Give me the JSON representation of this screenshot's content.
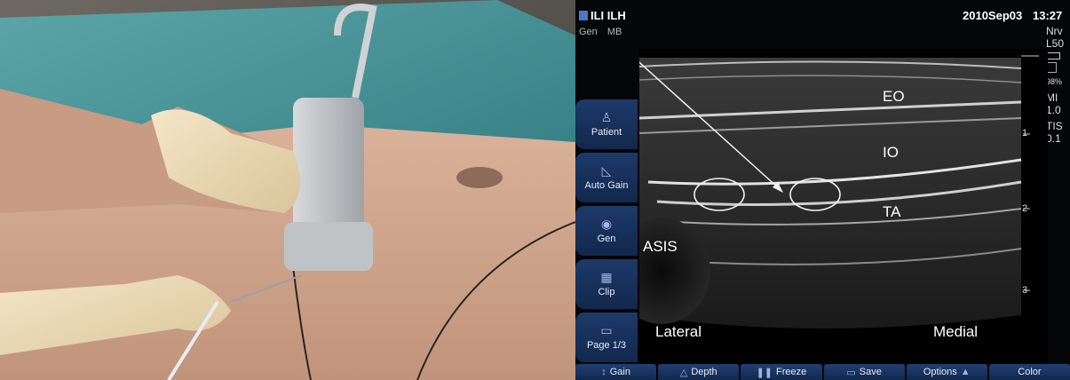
{
  "ultrasound": {
    "header": {
      "preset": "ILI ILH",
      "mode": "Gen",
      "side": "MB",
      "date": "2010Sep03",
      "time": "13:27"
    },
    "right_info": [
      "Nrv",
      "L50",
      "98%",
      "MI",
      "1.0",
      "TIS",
      "0.1"
    ],
    "sidebar": [
      {
        "label": "Patient",
        "icon": "person-icon"
      },
      {
        "label": "Auto Gain",
        "icon": "auto-gain-icon"
      },
      {
        "label": "Gen",
        "icon": "gen-icon"
      },
      {
        "label": "Clip",
        "icon": "clip-icon"
      },
      {
        "label": "Page 1/3",
        "icon": "page-icon"
      }
    ],
    "toolbar": [
      {
        "label": "Gain",
        "icon": "gain-icon"
      },
      {
        "label": "Depth",
        "icon": "depth-icon"
      },
      {
        "label": "Freeze",
        "icon": "freeze-icon"
      },
      {
        "label": "Save",
        "icon": "save-icon"
      },
      {
        "label": "Options",
        "icon": "options-icon"
      },
      {
        "label": "Color",
        "icon": "color-icon"
      }
    ],
    "labels": {
      "eo": "EO",
      "io": "IO",
      "ta": "TA",
      "asis": "ASIS",
      "lateral": "Lateral",
      "medial": "Medial"
    },
    "depth_scale": [
      "1",
      "2",
      "3"
    ]
  }
}
